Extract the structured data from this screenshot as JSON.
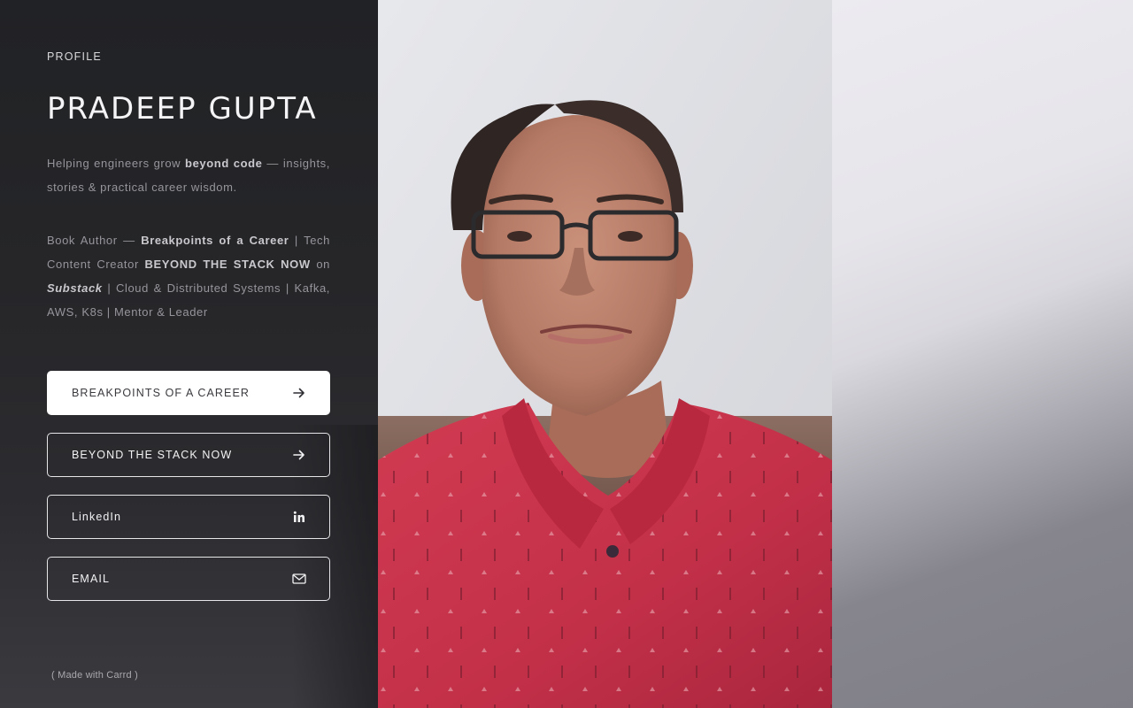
{
  "profile": {
    "eyebrow": "PROFILE",
    "name": "PRADEEP GUPTA",
    "tagline": {
      "pre": "Helping engineers grow ",
      "bold": "beyond code",
      "post": " — insights, stories & practical career wisdom."
    },
    "bio": {
      "p1": "Book Author — ",
      "b1": "Breakpoints of a Career",
      "p2": " | Tech Content Creator ",
      "b2": "BEYOND THE STACK NOW",
      "p3": " on ",
      "i1": "Substack",
      "p4": " | Cloud & Distributed Systems | Kafka, AWS, K8s | Mentor & Leader"
    }
  },
  "links": [
    {
      "label": "BREAKPOINTS OF A CAREER",
      "icon": "arrow-right-icon"
    },
    {
      "label": "BEYOND THE STACK NOW",
      "icon": "arrow-right-icon"
    },
    {
      "label": "LinkedIn",
      "icon": "linkedin-icon"
    },
    {
      "label": "EMAIL",
      "icon": "mail-icon"
    }
  ],
  "footer": {
    "text": "( Made with Carrd )"
  },
  "colors": {
    "panel": "#232326",
    "primary_button_bg": "#ffffff",
    "shirt": "#c8334a"
  }
}
